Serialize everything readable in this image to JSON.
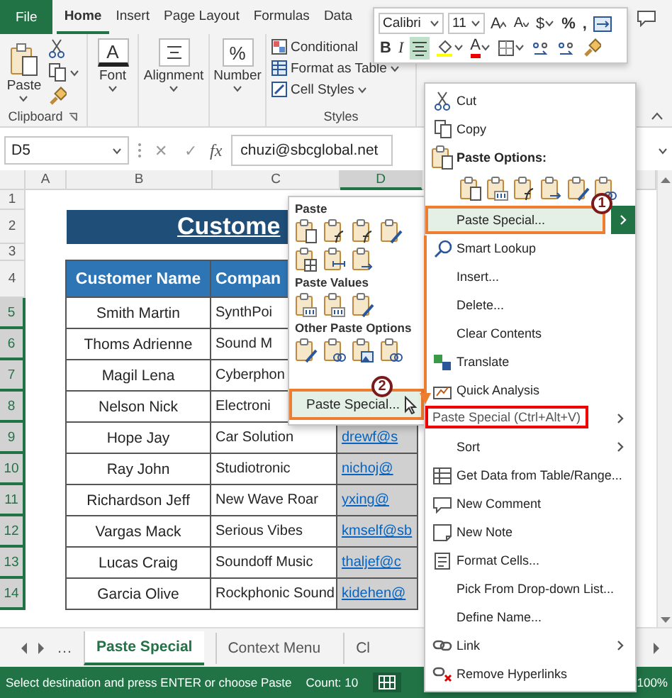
{
  "ribbon_tabs": [
    {
      "label": "File",
      "kind": "file",
      "selected": false
    },
    {
      "label": "Home",
      "kind": "tab",
      "selected": true
    },
    {
      "label": "Insert",
      "kind": "tab",
      "selected": false
    },
    {
      "label": "Page Layout",
      "kind": "tab",
      "selected": false
    },
    {
      "label": "Formulas",
      "kind": "tab",
      "selected": false
    },
    {
      "label": "Data",
      "kind": "tab",
      "selected": false
    }
  ],
  "clipboard_group": {
    "paste": "Paste",
    "label": "Clipboard"
  },
  "font_group": {
    "glyph": "A",
    "label": "Font"
  },
  "alignment_group": {
    "label": "Alignment"
  },
  "number_group": {
    "glyph": "%",
    "label": "Number"
  },
  "styles_group": {
    "items": [
      "Conditional",
      "Format as Table",
      "Cell Styles"
    ],
    "label": "Styles"
  },
  "mini_toolbar": {
    "row1": [
      {
        "kind": "font_box",
        "label": "Calibri"
      },
      {
        "kind": "size_box",
        "label": "11"
      },
      {
        "kind": "grow",
        "label": "A"
      },
      {
        "kind": "shrink",
        "label": "A"
      },
      {
        "kind": "currency",
        "label": "$"
      },
      {
        "kind": "plain",
        "label": "%"
      },
      {
        "kind": "plain",
        "label": ","
      },
      {
        "kind": "merge"
      }
    ],
    "row2": [
      {
        "kind": "bold",
        "label": "B",
        "selected": false
      },
      {
        "kind": "italic",
        "label": "I",
        "selected": false
      },
      {
        "kind": "align",
        "selected": true
      },
      {
        "kind": "fill",
        "selected": false
      },
      {
        "kind": "font_color",
        "label": "A",
        "selected": false
      },
      {
        "kind": "borders",
        "selected": false
      },
      {
        "kind": "decimal",
        "selected": false
      },
      {
        "kind": "decimal",
        "selected": false
      },
      {
        "kind": "painter",
        "selected": false
      }
    ]
  },
  "formula_bar": {
    "name_box": "D5",
    "cancel": "✕",
    "enter": "✓",
    "function": "fx",
    "formula": "chuzi@sbcglobal.net"
  },
  "sheet": {
    "columns": [
      {
        "label": "A",
        "selected": false
      },
      {
        "label": "B",
        "selected": false
      },
      {
        "label": "C",
        "selected": false
      },
      {
        "label": "D",
        "selected": true
      }
    ],
    "rows": [
      {
        "label": "1",
        "selected": false
      },
      {
        "label": "2",
        "selected": false
      },
      {
        "label": "3",
        "selected": false
      },
      {
        "label": "4",
        "selected": false
      },
      {
        "label": "5",
        "selected": true
      },
      {
        "label": "6",
        "selected": true
      },
      {
        "label": "7",
        "selected": true
      },
      {
        "label": "8",
        "selected": true
      },
      {
        "label": "9",
        "selected": true
      },
      {
        "label": "10",
        "selected": true
      },
      {
        "label": "11",
        "selected": true
      },
      {
        "label": "12",
        "selected": true
      },
      {
        "label": "13",
        "selected": true
      },
      {
        "label": "14",
        "selected": true
      }
    ]
  },
  "table": {
    "title": "Custome",
    "headers": [
      "Customer Name",
      "Compan"
    ],
    "rows": [
      {
        "name": "Smith Martin",
        "company": "SynthPoi"
      },
      {
        "name": "Thoms Adrienne",
        "company": "Sound M"
      },
      {
        "name": "Magil Lena",
        "company": "Cyberphon"
      },
      {
        "name": "Nelson  Nick",
        "company": "Electroni"
      },
      {
        "name": "Hope Jay",
        "company": "Car Solution",
        "email": "drewf@s"
      },
      {
        "name": "Ray John",
        "company": "Studiotronic",
        "email": "nichoj@"
      },
      {
        "name": "Richardson Jeff",
        "company": "New Wave Roar",
        "email": "yxing@"
      },
      {
        "name": "Vargas  Mack",
        "company": "Serious Vibes",
        "email": "kmself@sb"
      },
      {
        "name": "Lucas  Craig",
        "company": "Soundoff Music",
        "email": "thaljef@c"
      },
      {
        "name": "Garcia Olive",
        "company": "Rockphonic Sound",
        "email": "kidehen@"
      }
    ]
  },
  "paste_submenu": {
    "sections": [
      {
        "title": "Paste"
      },
      {
        "title": "Paste Values"
      },
      {
        "title": "Other Paste Options"
      }
    ],
    "button": "Paste Special...",
    "badge": "2"
  },
  "context_menu": {
    "badge": "1",
    "tooltip": "Paste Special (Ctrl+Alt+V)",
    "items": [
      {
        "kind": "item",
        "label": "Cut",
        "highlighted": false,
        "submenu": false
      },
      {
        "kind": "item",
        "label": "Copy",
        "highlighted": false,
        "submenu": false
      },
      {
        "kind": "header",
        "label": "Paste Options:",
        "highlighted": false,
        "submenu": false
      },
      {
        "kind": "icons",
        "highlighted": false,
        "submenu": false
      },
      {
        "kind": "item",
        "label": "Paste Special...",
        "highlighted": true,
        "submenu": true
      },
      {
        "kind": "item",
        "label": "Smart Lookup",
        "highlighted": false,
        "submenu": false
      },
      {
        "kind": "item",
        "label": "Insert...",
        "highlighted": false,
        "submenu": false
      },
      {
        "kind": "item",
        "label": "Delete...",
        "highlighted": false,
        "submenu": false
      },
      {
        "kind": "item",
        "label": "Clear Contents",
        "highlighted": false,
        "submenu": false
      },
      {
        "kind": "item",
        "label": "Translate",
        "highlighted": false,
        "submenu": false
      },
      {
        "kind": "item",
        "label": "Quick Analysis",
        "highlighted": false,
        "submenu": false
      },
      {
        "kind": "covered",
        "highlighted": false,
        "submenu": true
      },
      {
        "kind": "item",
        "label": "Sort",
        "highlighted": false,
        "submenu": true
      },
      {
        "kind": "item",
        "label": "Get Data from Table/Range...",
        "highlighted": false,
        "submenu": false
      },
      {
        "kind": "item",
        "label": "New Comment",
        "highlighted": false,
        "submenu": false
      },
      {
        "kind": "item",
        "label": "New Note",
        "highlighted": false,
        "submenu": false
      },
      {
        "kind": "item",
        "label": "Format Cells...",
        "highlighted": false,
        "submenu": false
      },
      {
        "kind": "item",
        "label": "Pick From Drop-down List...",
        "highlighted": false,
        "submenu": false
      },
      {
        "kind": "item",
        "label": "Define Name...",
        "highlighted": false,
        "submenu": false
      },
      {
        "kind": "item",
        "label": "Link",
        "highlighted": false,
        "submenu": true
      },
      {
        "kind": "item",
        "label": "Remove Hyperlinks",
        "highlighted": false,
        "submenu": false
      }
    ]
  },
  "sheet_tabs": {
    "more": "…",
    "tabs": [
      {
        "label": "Paste Special",
        "selected": true
      },
      {
        "label": "Context Menu",
        "selected": false
      },
      {
        "label": "Cl",
        "selected": false
      }
    ]
  },
  "status_bar": {
    "message": "Select destination and press ENTER or choose Paste",
    "count": "Count: 10",
    "zoom": "100%"
  }
}
